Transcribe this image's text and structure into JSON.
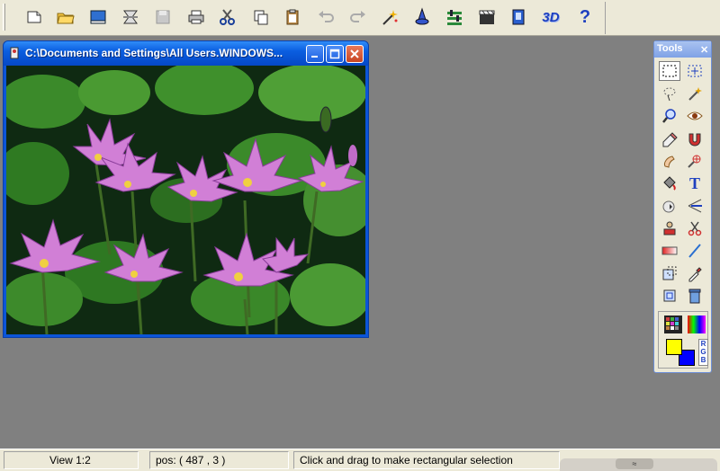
{
  "toolbar": {
    "buttons": [
      {
        "name": "new-file",
        "icon": "new-file-icon"
      },
      {
        "name": "open",
        "icon": "open-folder-icon"
      },
      {
        "name": "browse",
        "icon": "book-icon"
      },
      {
        "name": "scan",
        "icon": "scanner-icon"
      },
      {
        "name": "save",
        "icon": "save-icon"
      },
      {
        "name": "print",
        "icon": "printer-icon"
      },
      {
        "name": "cut",
        "icon": "scissors-icon"
      },
      {
        "name": "copy",
        "icon": "copy-icon"
      },
      {
        "name": "paste",
        "icon": "clipboard-icon"
      },
      {
        "name": "undo",
        "icon": "undo-icon"
      },
      {
        "name": "redo",
        "icon": "redo-icon"
      },
      {
        "name": "effects",
        "icon": "magic-wand-icon"
      },
      {
        "name": "wizard",
        "icon": "wizard-icon"
      },
      {
        "name": "adjust",
        "icon": "sliders-icon"
      },
      {
        "name": "animation",
        "icon": "film-clapper-icon"
      },
      {
        "name": "album",
        "icon": "album-icon"
      },
      {
        "name": "3d",
        "icon": "3d-icon",
        "label": "3D"
      },
      {
        "name": "help",
        "icon": "help-icon",
        "label": "?"
      }
    ]
  },
  "image_window": {
    "title": "C:\\Documents and Settings\\All Users.WINDOWS...",
    "minimize_icon": "minimize-icon",
    "maximize_icon": "maximize-icon",
    "close_icon": "close-icon"
  },
  "tools_palette": {
    "title": "Tools",
    "close_label": "✕",
    "tools": [
      "rect-select-icon",
      "move-selection-icon",
      "lasso-icon",
      "magic-wand-select-icon",
      "zoom-icon",
      "eye-icon",
      "eraser-icon",
      "magnet-icon",
      "smudge-icon",
      "clone-icon",
      "paint-bucket-icon",
      "text-icon",
      "airbrush-icon",
      "line-icon",
      "stamp-icon",
      "scissors-tool-icon",
      "gradient-icon",
      "pencil-line-icon",
      "transform-icon",
      "eyedropper-icon",
      "crop-icon",
      "trash-icon"
    ],
    "text_tool_label": "T",
    "colors": {
      "foreground": "#ffff00",
      "background": "#0000ff",
      "rgb_label": "RGB"
    }
  },
  "statusbar": {
    "view": "View 1:2",
    "pos": "pos: ( 487 , 3 )",
    "hint": "Click and drag to make rectangular selection",
    "scroll_glyph": "≈"
  }
}
